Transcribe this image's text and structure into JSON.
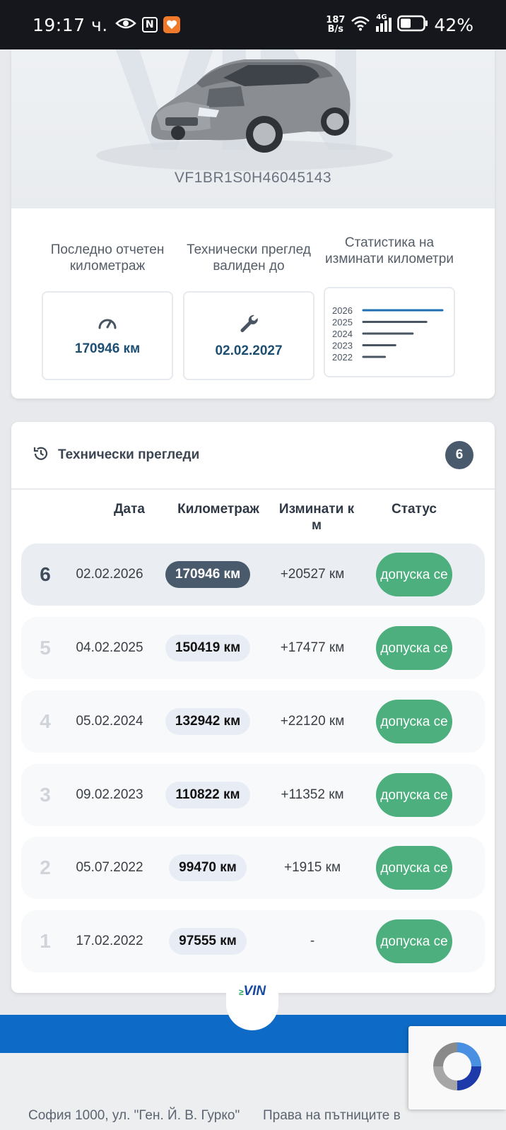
{
  "status_bar": {
    "time": "19:17 ч.",
    "speed_value": "187",
    "speed_unit": "B/s",
    "network": "4G",
    "battery": "42%"
  },
  "vehicle": {
    "vin": "VF1BR1S0H46045143",
    "watermark": "VIN"
  },
  "stats": {
    "mileage_label": "Последно отчетен километраж",
    "mileage_value": "170946 км",
    "inspection_label": "Технически преглед валиден до",
    "inspection_value": "02.02.2027",
    "statistics_label": "Статистика на изминати километри",
    "mini_chart": {
      "years": [
        "2026",
        "2025",
        "2024",
        "2023",
        "2022"
      ],
      "km": [
        170946,
        150419,
        132942,
        110822,
        97555
      ],
      "highlight_color": "#1f6fb2",
      "bar_color": "#4a5563"
    }
  },
  "inspections": {
    "title": "Технически прегледи",
    "count": "6",
    "headers": {
      "date": "Дата",
      "mileage": "Километраж",
      "diff": "Изминати к м",
      "status": "Статус"
    },
    "rows": [
      {
        "num": "6",
        "date": "02.02.2026",
        "km": "170946 км",
        "diff": "+20527 км",
        "status": "допуска се"
      },
      {
        "num": "5",
        "date": "04.02.2025",
        "km": "150419 км",
        "diff": "+17477 км",
        "status": "допуска се"
      },
      {
        "num": "4",
        "date": "05.02.2024",
        "km": "132942 км",
        "diff": "+22120 км",
        "status": "допуска се"
      },
      {
        "num": "3",
        "date": "09.02.2023",
        "km": "110822 км",
        "diff": "+11352 км",
        "status": "допуска се"
      },
      {
        "num": "2",
        "date": "05.07.2022",
        "km": "99470 км",
        "diff": "+1915 км",
        "status": "допуска се"
      },
      {
        "num": "1",
        "date": "17.02.2022",
        "km": "97555 км",
        "diff": "-",
        "status": "допуска се"
      }
    ]
  },
  "footer": {
    "logo_text": "VIN",
    "address": "София 1000, ул. \"Ген. Й. В. Гурко\"",
    "rights": "Права на пътниците в"
  },
  "colors": {
    "accent_blue": "#0d6bc7",
    "status_green": "#4caf7d",
    "active_pill": "#495a6c"
  }
}
